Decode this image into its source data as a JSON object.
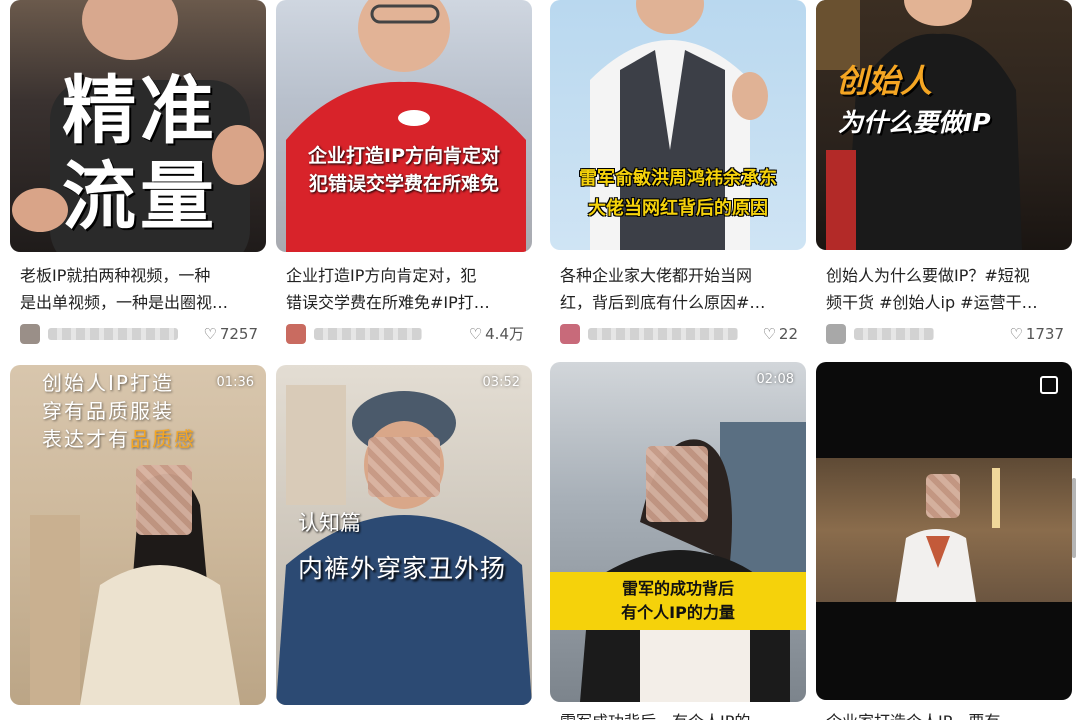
{
  "feed": [
    {
      "overlay_lines": [
        "精准",
        "流量"
      ],
      "duration": "",
      "caption_lines": [
        "老板IP就拍两种视频，一种",
        "是出单视频，一种是出圈视…"
      ],
      "likes": "7257"
    },
    {
      "overlay_lines": [
        "企业打造IP方向肯定对",
        "犯错误交学费在所难免"
      ],
      "duration": "",
      "caption_lines": [
        "企业打造IP方向肯定对，犯",
        "错误交学费在所难免#IP打…"
      ],
      "likes": "4.4万"
    },
    {
      "overlay_lines": [
        "雷军俞敏洪周鸿祎余承东",
        "大佬当网红背后的原因"
      ],
      "duration": "",
      "caption_lines": [
        "各种企业家大佬都开始当网",
        "红，背后到底有什么原因#…"
      ],
      "likes": "22"
    },
    {
      "overlay_lines": [
        "创始人",
        "为什么要做IP"
      ],
      "duration": "",
      "caption_lines": [
        "创始人为什么要做IP？#短视",
        "频干货 #创始人ip #运营干…"
      ],
      "likes": "1737"
    },
    {
      "overlay_lines": [
        "创始人IP打造",
        "穿有品质服装",
        "表达才有",
        "品质感"
      ],
      "duration": "01:36",
      "caption_lines": [
        "",
        ""
      ],
      "likes": ""
    },
    {
      "overlay_lines": [
        "认知篇",
        "内裤外穿家丑外扬"
      ],
      "duration": "03:52",
      "caption_lines": [
        "",
        ""
      ],
      "likes": ""
    },
    {
      "overlay_lines": [
        "雷军的成功背后",
        "有个人IP的力量"
      ],
      "duration": "02:08",
      "caption_lines": [
        "雷军成功背后，有个人IP的…",
        ""
      ],
      "likes": ""
    },
    {
      "overlay_lines": [],
      "duration": "",
      "caption_lines": [
        "企业家打造个人IP，要有…",
        ""
      ],
      "likes": ""
    }
  ],
  "icons": {
    "like": "heart-icon",
    "multi": "multi-image-icon"
  },
  "colors": {
    "yellow": "#f5d20b",
    "orange": "#f5a623",
    "red_shirt": "#d8232a",
    "text": "#222222"
  }
}
